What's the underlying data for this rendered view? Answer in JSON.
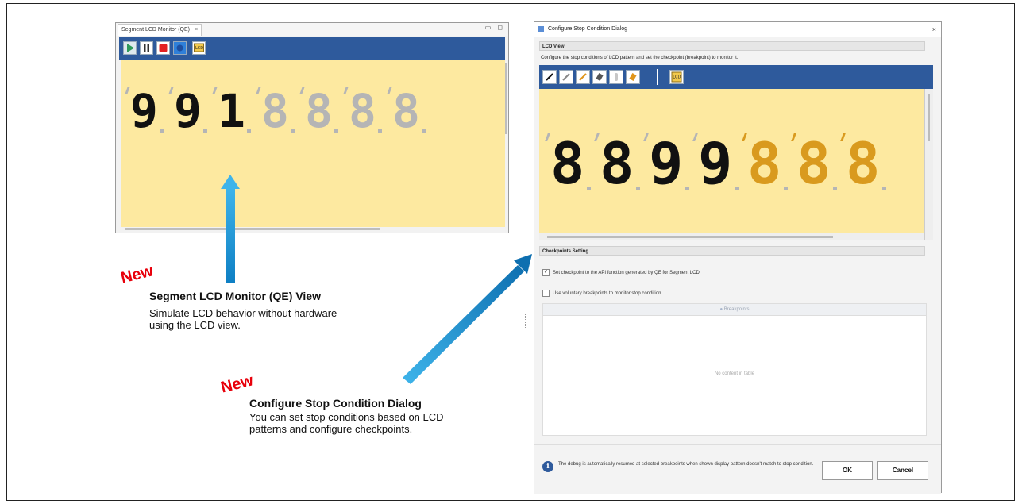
{
  "monitor": {
    "tab_title": "Segment LCD Monitor (QE)",
    "tab_close": "×",
    "window_buttons": "▭ ◻",
    "digits": [
      {
        "glyph": "9",
        "active": true
      },
      {
        "glyph": "9",
        "active": true
      },
      {
        "glyph": "1",
        "active": true
      },
      {
        "glyph": "8",
        "active": false
      },
      {
        "glyph": "8",
        "active": false
      },
      {
        "glyph": "8",
        "active": false
      },
      {
        "glyph": "8",
        "active": false
      }
    ],
    "toolbar_icons": [
      "play-icon",
      "pause-icon",
      "stop-icon",
      "record-icon",
      "lcd-settings-icon"
    ]
  },
  "annotation1": {
    "new_label": "New",
    "title": "Segment LCD Monitor (QE) View",
    "desc_line1": "Simulate LCD behavior without hardware",
    "desc_line2": "using the LCD view."
  },
  "annotation2": {
    "new_label": "New",
    "title": "Configure Stop Condition Dialog",
    "desc_line1": "You can set stop conditions based on LCD",
    "desc_line2": "patterns and configure checkpoints."
  },
  "dialog": {
    "title": "Configure Stop Condition Dialog",
    "close": "×",
    "lcd_view_header": "LCD View",
    "description": "Configure the stop conditions of LCD pattern and set the checkpoint (breakpoint) to monitor it.",
    "checkpoints_header": "Checkpoints Setting",
    "check1_label": "Set checkpoint to the API function generated by QE for Segment LCD",
    "check1_mark": "✓",
    "check2_label": "Use voluntary breakpoints to monitor stop condition",
    "breakpoints_header": "Breakpoints",
    "empty_table": "No content in table",
    "info_text": "The debug is automatically resumed at selected breakpoints when shown display pattern doesn't match to stop condition.",
    "ok_label": "OK",
    "cancel_label": "Cancel",
    "digits": [
      {
        "glyph": "8",
        "state": "black"
      },
      {
        "glyph": "8",
        "state": "black"
      },
      {
        "glyph": "9",
        "state": "black"
      },
      {
        "glyph": "9",
        "state": "black"
      },
      {
        "glyph": "8",
        "state": "orange"
      },
      {
        "glyph": "8",
        "state": "orange"
      },
      {
        "glyph": "8",
        "state": "orange"
      }
    ],
    "toolbar_icons": [
      "pencil-black-icon",
      "pencil-outline-icon",
      "pencil-orange-icon",
      "eraser-icon",
      "hand-icon",
      "fill-icon",
      "lcd-settings-icon"
    ]
  },
  "colors": {
    "toolbar": "#2e5a9c",
    "lcd_bg": "#fde9a0",
    "active_segment": "#111111",
    "inactive_segment": "#b5b5b5",
    "orange_segment": "#d99a1e",
    "new_red": "#e8000b",
    "arrow_start": "#0e7fc4",
    "arrow_end": "#3eb4ea"
  }
}
